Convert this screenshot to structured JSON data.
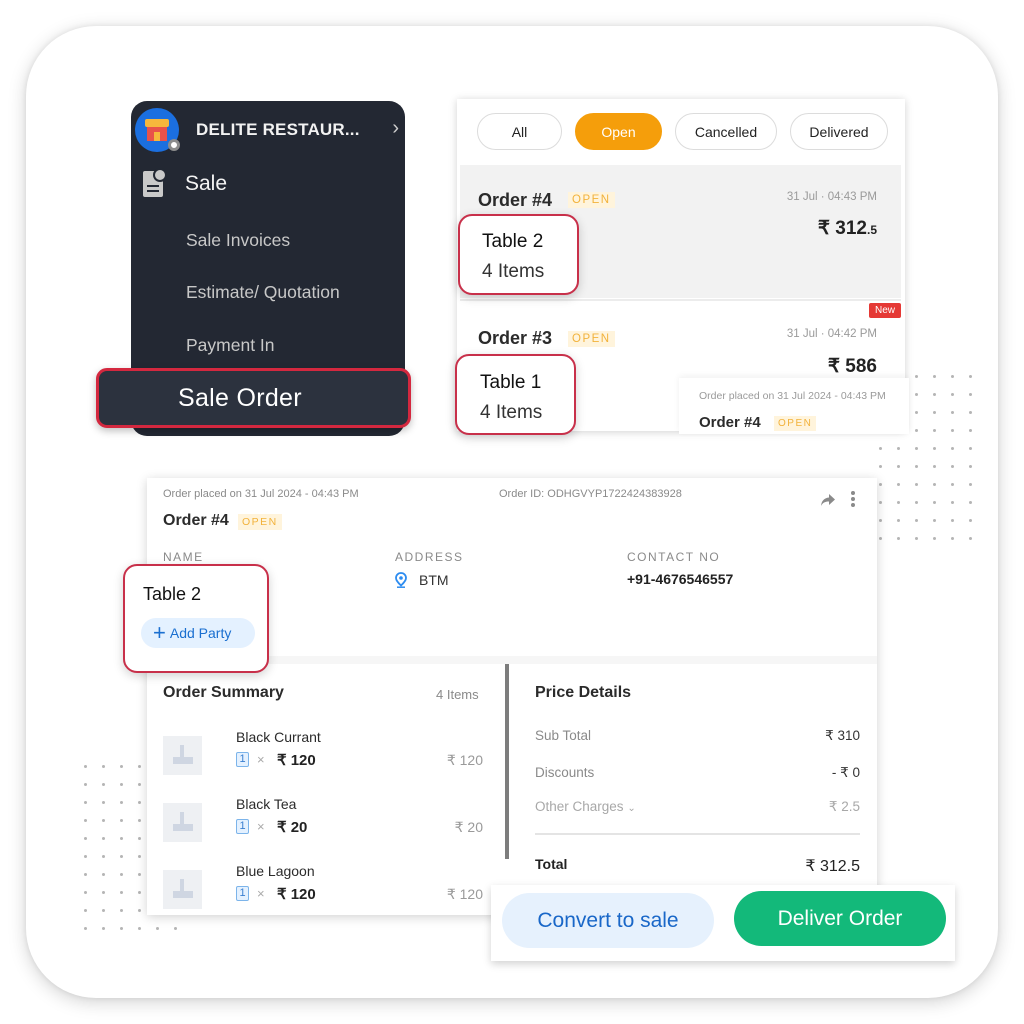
{
  "sidebar": {
    "business_name": "DELITE RESTAUR...",
    "section": "Sale",
    "items": [
      {
        "label": "Sale Invoices"
      },
      {
        "label": "Estimate/ Quotation"
      },
      {
        "label": "Payment In"
      },
      {
        "label": "Sale Order"
      }
    ]
  },
  "orders_list": {
    "tabs": [
      {
        "label": "All",
        "active": false
      },
      {
        "label": "Open",
        "active": true
      },
      {
        "label": "Cancelled",
        "active": false
      },
      {
        "label": "Delivered",
        "active": false
      }
    ],
    "orders": [
      {
        "title": "Order #4",
        "status": "OPEN",
        "time": "31 Jul · 04:43 PM",
        "amount_main": "₹ 312",
        "amount_decimal": ".5",
        "table": "Table 2",
        "items": "4 Items"
      },
      {
        "title": "Order #3",
        "status": "OPEN",
        "time": "31 Jul · 04:42 PM",
        "amount_main": "₹ 586",
        "amount_decimal": "",
        "badge": "New",
        "table": "Table 1",
        "items": "4 Items"
      }
    ],
    "preview": {
      "placed": "Order placed on 31 Jul 2024 - 04:43 PM",
      "title": "Order #4",
      "status": "OPEN"
    }
  },
  "detail": {
    "placed": "Order placed on 31 Jul 2024 - 04:43 PM",
    "order_id": "Order ID: ODHGVYP1722424383928",
    "title": "Order #4",
    "status": "OPEN",
    "labels": {
      "name": "NAME",
      "address": "ADDRESS",
      "contact": "CONTACT NO"
    },
    "name_value": "Table 2",
    "add_party_label": "Add Party",
    "address": "BTM",
    "contact": "+91-4676546557",
    "summary": {
      "title": "Order Summary",
      "count": "4 Items",
      "items": [
        {
          "name": "Black Currant",
          "qty": "1",
          "unit_price": "₹ 120",
          "total": "₹ 120"
        },
        {
          "name": "Black Tea",
          "qty": "1",
          "unit_price": "₹ 20",
          "total": "₹ 20"
        },
        {
          "name": "Blue Lagoon",
          "qty": "1",
          "unit_price": "₹ 120",
          "total": "₹ 120"
        }
      ]
    },
    "price": {
      "title": "Price Details",
      "rows": [
        {
          "label": "Sub Total",
          "value": "₹ 310"
        },
        {
          "label": "Discounts",
          "value": "- ₹ 0"
        },
        {
          "label": "Other Charges",
          "value": "₹ 2.5"
        }
      ],
      "total_label": "Total",
      "total_value": "₹ 312.5"
    },
    "actions": {
      "convert": "Convert to sale",
      "deliver": "Deliver Order"
    }
  },
  "colors": {
    "accent_open": "#f59e0b",
    "highlight_border": "#c8304a",
    "deliver_green": "#13b97a",
    "convert_blue": "#1967c8",
    "sidebar_bg": "#232833"
  }
}
